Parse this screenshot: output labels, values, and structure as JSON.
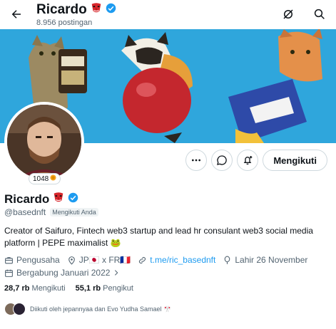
{
  "header": {
    "name": "Ricardo",
    "posts": "8.956 postingan"
  },
  "avatar": {
    "badge_count": "1048"
  },
  "actions": {
    "follow_label": "Mengikuti"
  },
  "profile": {
    "name": "Ricardo",
    "handle": "@basednft",
    "follows_you": "Mengikuti Anda",
    "bio": "Creator of Saifuro, Fintech web3 startup and lead hr consulant web3 social media platform | PEPE maximalist 🐸",
    "occupation": "Pengusaha",
    "location": "JP🇯🇵 x FR🇫🇷",
    "website": "t.me/ric_basednft",
    "birthday": "Lahir 26 November",
    "joined": "Bergabung Januari 2022"
  },
  "stats": {
    "following_count": "28,7 rb",
    "following_label": "Mengikuti",
    "followers_count": "55,1 rb",
    "followers_label": "Pengikut"
  },
  "followed_by": "Diikuti oleh jepannyaa dan Evo Yudha Samael 🎌",
  "colors": {
    "accent": "#1d9bf0",
    "banner": "#2fa6dc",
    "muted": "#536471"
  }
}
